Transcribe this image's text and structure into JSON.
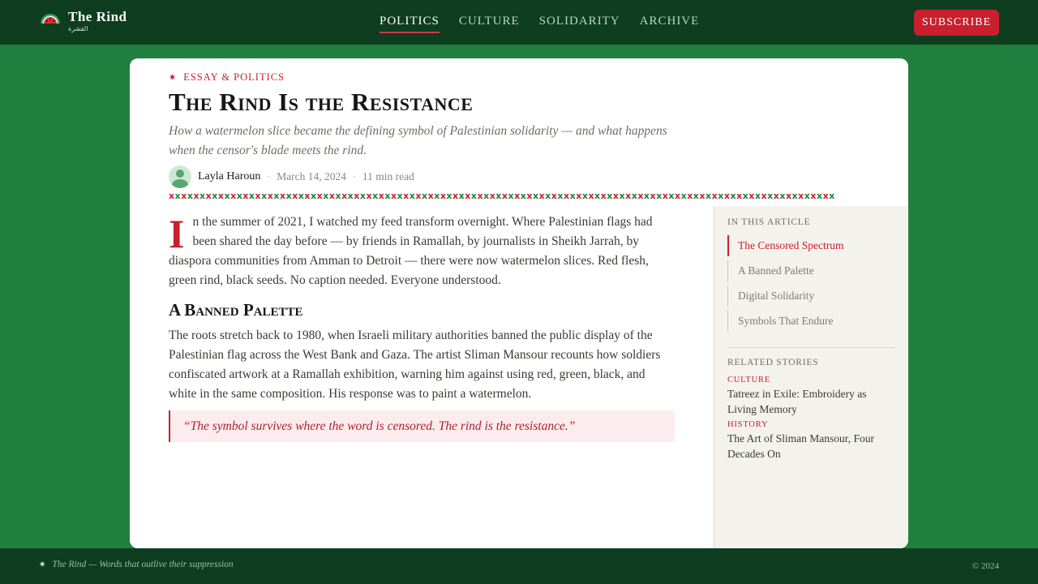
{
  "header": {
    "brand_title": "The Rind",
    "brand_subtitle": "القشرة",
    "nav": [
      {
        "label": "POLITICS",
        "active": true
      },
      {
        "label": "CULTURE",
        "active": false
      },
      {
        "label": "SOLIDARITY",
        "active": false
      },
      {
        "label": "ARCHIVE",
        "active": false
      }
    ],
    "subscribe_label": "SUBSCRIBE"
  },
  "article": {
    "kicker": "ESSAY & POLITICS",
    "title": "The Rind Is the Resistance",
    "dek": "How a watermelon slice became the defining symbol of Palestinian solidarity — and what happens when the censor's blade meets the rind.",
    "author": "Layla Haroun",
    "date": "March 14, 2024",
    "read_time": "11 min read",
    "dropcap": "I",
    "intro": "n the summer of 2021, I watched my feed transform overnight. Where Palestinian flags had been shared the day before — by friends in Ramallah, by journalists in Sheikh Jarrah, by diaspora communities from Amman to Detroit — there were now watermelon slices. Red flesh, green rind, black seeds. No caption needed. Everyone understood.",
    "section_heading": "A Banned Palette",
    "section_body": "The roots stretch back to 1980, when Israeli military authorities banned the public display of the Palestinian flag across the West Bank and Gaza. The artist Sliman Mansour recounts how soldiers confiscated artwork at a Ramallah exhibition, warning him against using red, green, black, and white in the same composition. His response was to paint a watermelon.",
    "pullquote": "“The symbol survives where the word is censored. The rind is the resistance.”"
  },
  "sidebar": {
    "toc_heading": "IN THIS ARTICLE",
    "toc": [
      {
        "label": "The Censored Spectrum",
        "active": true
      },
      {
        "label": "A Banned Palette",
        "active": false
      },
      {
        "label": "Digital Solidarity",
        "active": false
      },
      {
        "label": "Symbols That Endure",
        "active": false
      }
    ],
    "related_heading": "RELATED STORIES",
    "related": [
      {
        "tag": "CULTURE",
        "title": "Tatreez in Exile: Embroidery as Living Memory"
      },
      {
        "tag": "HISTORY",
        "title": "The Art of Sliman Mansour, Four Decades On"
      }
    ]
  },
  "footer": {
    "tagline": "The Rind — Words that outlive their suppression",
    "copyright": "© 2024"
  },
  "colors": {
    "page_green": "#20803f",
    "header_green": "#0f3d1f",
    "accent_red": "#c8202e",
    "sidebar_bg": "#f4f2ed",
    "quote_bg": "#fdecee"
  },
  "icons": {
    "brand": "watermelon-slice-icon",
    "kicker": "asterisk-star-icon",
    "footer": "asterisk-star-icon"
  }
}
